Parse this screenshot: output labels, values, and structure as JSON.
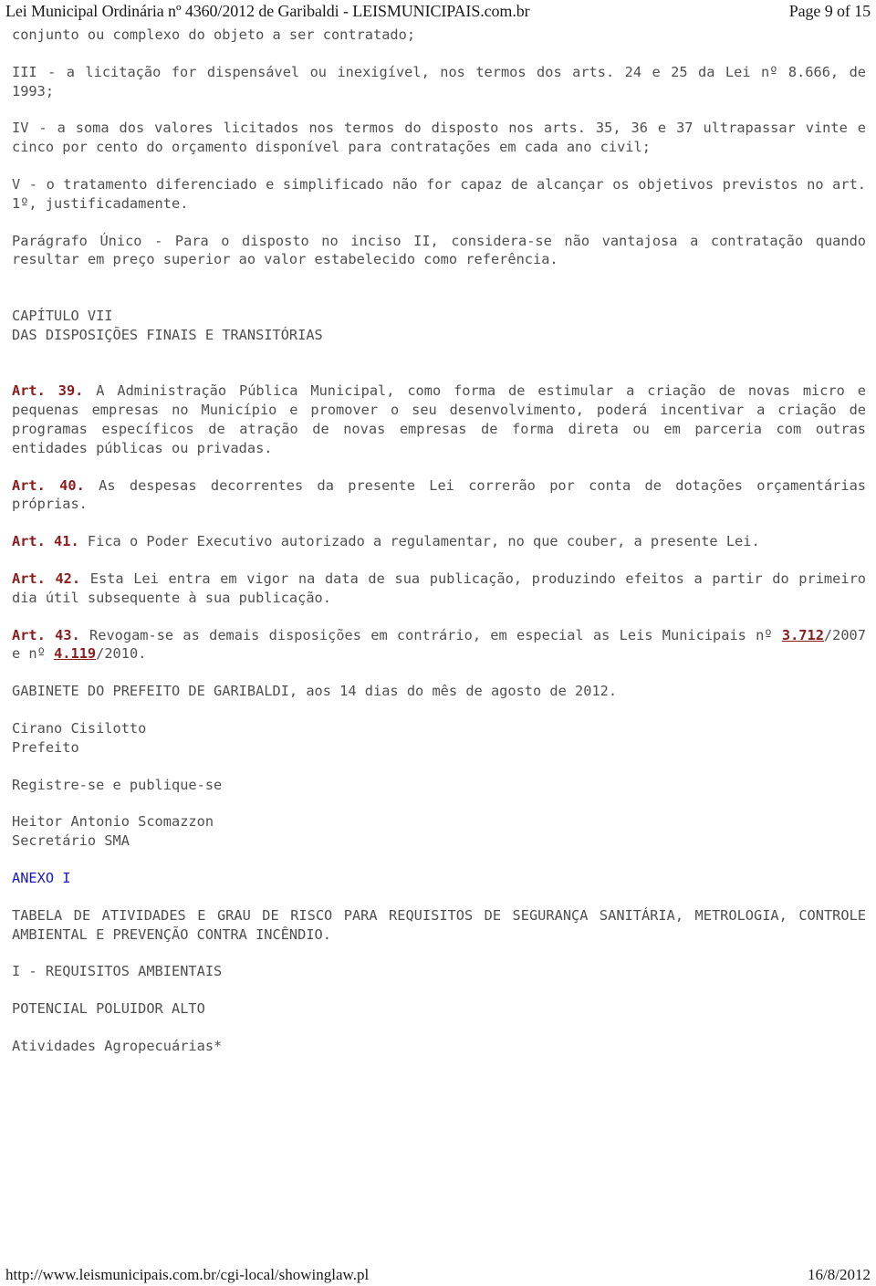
{
  "header": {
    "title": "Lei Municipal Ordinária nº 4360/2012 de Garibaldi - LEISMUNICIPAIS.com.br",
    "page_indicator": "Page 9 of 15"
  },
  "footer": {
    "url": "http://www.leismunicipais.com.br/cgi-local/showinglaw.pl",
    "date": "16/8/2012"
  },
  "colors": {
    "body_text": "#4f4f4f",
    "article_label": "#8a1c1c",
    "law_link": "#8a1c1c",
    "anexo_link": "#1616c8",
    "header_text": "#1a1a1a",
    "page_background": "#ffffff"
  },
  "body": {
    "continuation_line": "conjunto ou complexo do objeto a ser contratado;",
    "inciso_iii": "III - a licitação for dispensável ou inexigível, nos termos dos arts. 24 e 25 da Lei nº 8.666, de 1993;",
    "inciso_iv": "IV - a soma dos valores licitados nos termos do disposto nos arts. 35, 36 e 37 ultrapassar vinte e cinco por cento do orçamento disponível para contratações em cada ano civil;",
    "inciso_v": "V - o tratamento diferenciado e simplificado não for capaz de alcançar os objetivos previstos no art. 1º, justificadamente.",
    "paragrafo_unico": "Parágrafo Único - Para o disposto no inciso II, considera-se não vantajosa a contratação quando resultar em preço superior ao valor estabelecido como referência.",
    "capitulo_heading": "CAPÍTULO VII",
    "capitulo_subheading": "DAS DISPOSIÇÕES FINAIS E TRANSITÓRIAS",
    "art39_label": "Art. 39.",
    "art39_text": " A Administração Pública Municipal, como forma de estimular a criação de novas micro e pequenas empresas no Município e promover o seu desenvolvimento, poderá incentivar a criação de programas específicos de atração de novas empresas de forma direta ou em parceria com outras entidades públicas ou privadas.",
    "art40_label": "Art. 40.",
    "art40_text": " As despesas decorrentes da presente Lei correrão por conta de dotações orçamentárias próprias.",
    "art41_label": "Art. 41.",
    "art41_text": " Fica o Poder Executivo autorizado a regulamentar, no que couber, a presente Lei.",
    "art42_label": "Art. 42.",
    "art42_text": " Esta Lei entra em vigor na data de sua publicação, produzindo efeitos a partir do primeiro dia útil subsequente à sua publicação.",
    "art43_label": "Art. 43.",
    "art43_text_part1": " Revogam-se as demais disposições em contrário, em especial as Leis Municipais nº ",
    "art43_link1": "3.712",
    "art43_text_part2": "/2007 e nº ",
    "art43_link2": "4.119",
    "art43_text_part3": "/2010.",
    "gabinete": "GABINETE DO PREFEITO DE GARIBALDI, aos 14 dias do mês de agosto de 2012.",
    "signer1_name": "Cirano Cisilotto",
    "signer1_role": "Prefeito",
    "registre": "Registre-se e publique-se",
    "signer2_name": "Heitor Antonio Scomazzon",
    "signer2_role": "Secretário SMA",
    "anexo_link": "ANEXO I",
    "tabela_title": "TABELA DE ATIVIDADES E GRAU DE RISCO PARA REQUISITOS DE SEGURANÇA SANITÁRIA, METROLOGIA, CONTROLE AMBIENTAL E PREVENÇÃO CONTRA INCÊNDIO.",
    "secao_i": "I - REQUISITOS AMBIENTAIS",
    "potencial": "POTENCIAL POLUIDOR ALTO",
    "atividades": "Atividades Agropecuárias*"
  }
}
